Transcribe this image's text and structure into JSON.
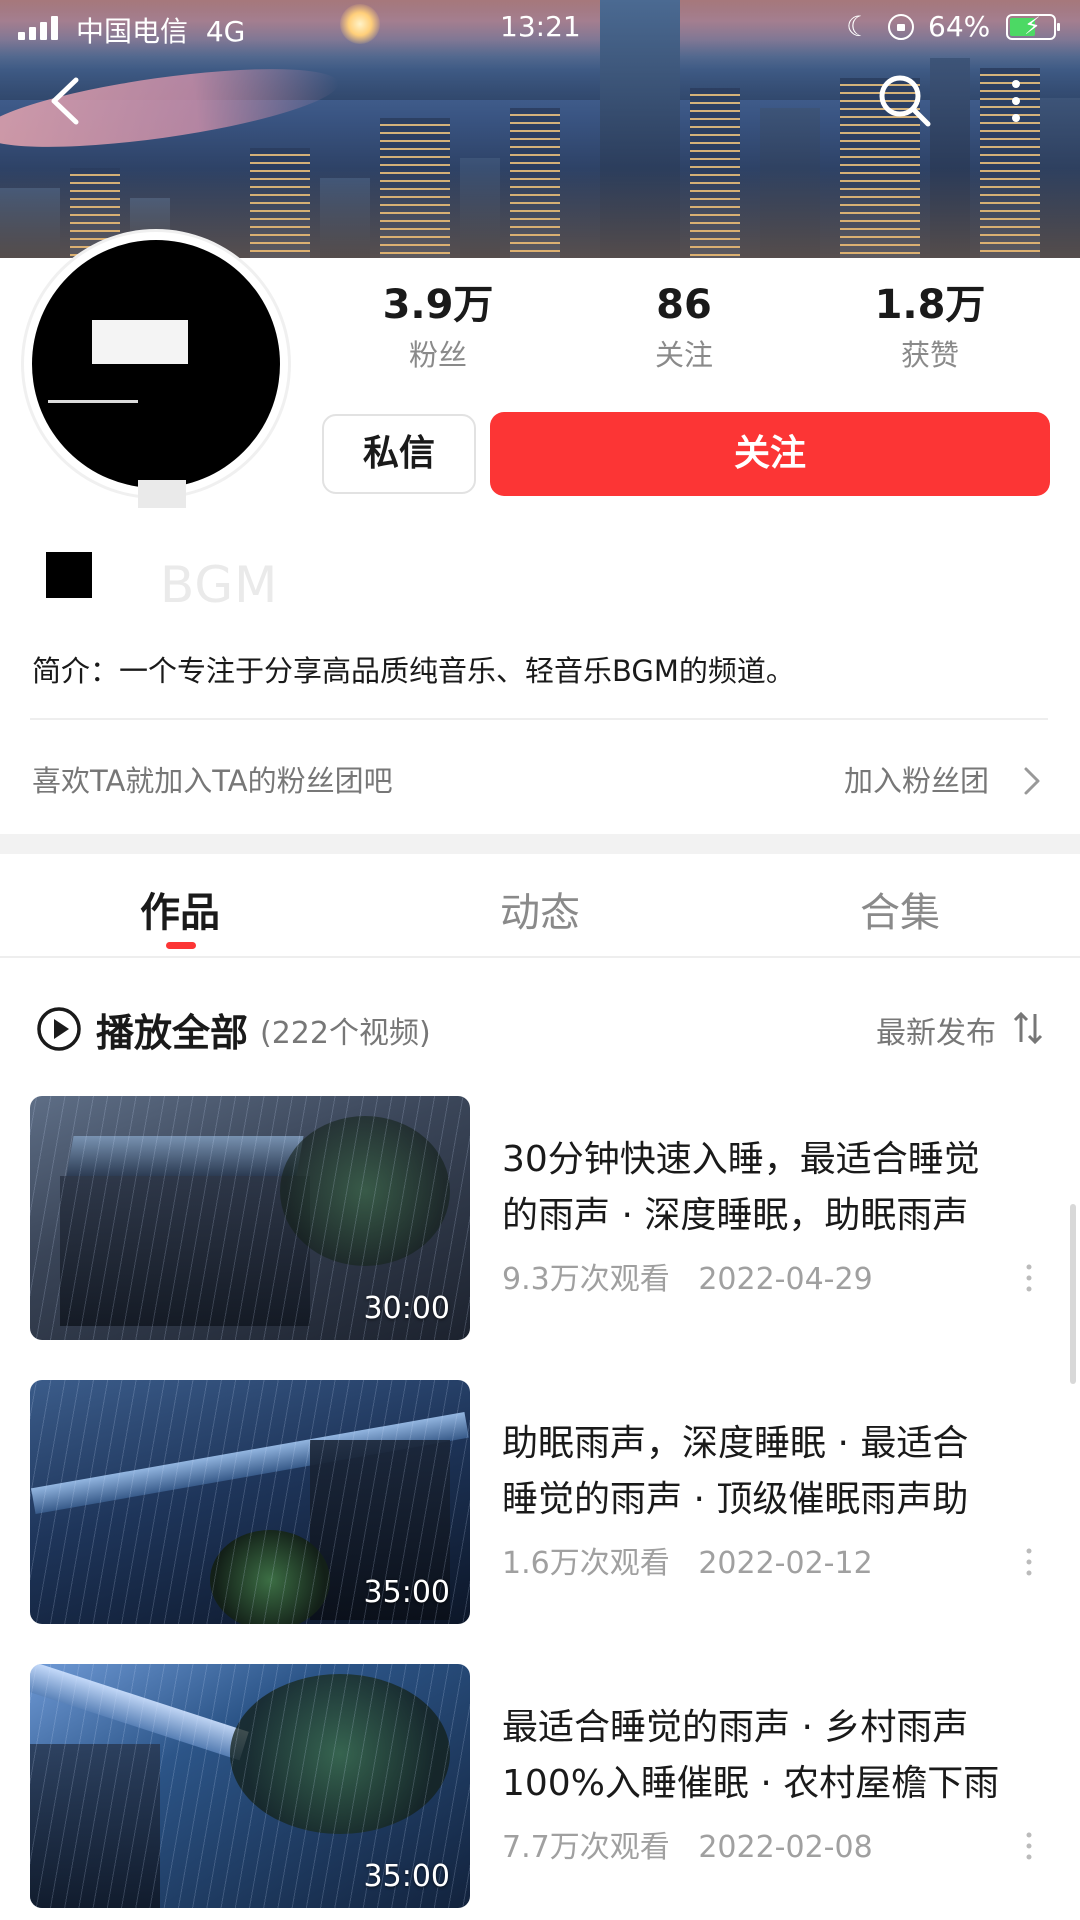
{
  "status_bar": {
    "carrier": "中国电信",
    "network": "4G",
    "time": "13:21",
    "battery_percent": "64%",
    "battery_level": 0.64,
    "battery_color": "#4cd964"
  },
  "header_icons": {
    "back": "chevron-left-icon",
    "search": "search-icon",
    "more": "more-vertical-icon"
  },
  "profile": {
    "username_visible": "BGM",
    "bio": "简介：一个专注于分享高品质纯音乐、轻音乐BGM的频道。",
    "stats": [
      {
        "value": "3.9万",
        "label": "粉丝"
      },
      {
        "value": "86",
        "label": "关注"
      },
      {
        "value": "1.8万",
        "label": "获赞"
      }
    ],
    "message_button": "私信",
    "follow_button": "关注",
    "fan_club_prompt": "喜欢TA就加入TA的粉丝团吧",
    "fan_club_action": "加入粉丝团"
  },
  "tabs": [
    {
      "label": "作品",
      "active": true
    },
    {
      "label": "动态",
      "active": false
    },
    {
      "label": "合集",
      "active": false
    }
  ],
  "playlist": {
    "play_all": "播放全部",
    "count": "(222个视频)",
    "sort_label": "最新发布"
  },
  "videos": [
    {
      "title": "30分钟快速入睡，最适合睡觉的雨声 · 深度睡眠，助眠雨声",
      "title_line1": "30分钟快速入睡，最适合睡觉",
      "title_line2": "的雨声 · 深度睡眠，助眠雨声",
      "views": "9.3万次观看",
      "date": "2022-04-29",
      "duration": "30:00"
    },
    {
      "title": "助眠雨声，深度睡眠 · 最适合睡觉的雨声 · 顶级催眠雨声助",
      "title_line1": "助眠雨声，深度睡眠 · 最适合",
      "title_line2": "睡觉的雨声 · 顶级催眠雨声助",
      "views": "1.6万次观看",
      "date": "2022-02-12",
      "duration": "35:00"
    },
    {
      "title": "最适合睡觉的雨声 · 乡村雨声100%入睡催眠 · 农村屋檐下雨",
      "title_line1": "最适合睡觉的雨声 · 乡村雨声",
      "title_line2": "100%入睡催眠 · 农村屋檐下雨",
      "views": "7.7万次观看",
      "date": "2022-02-08",
      "duration": "35:00"
    }
  ],
  "colors": {
    "accent": "#fc3535",
    "text_primary": "#1a1a1a",
    "text_secondary": "#8a8a8a"
  }
}
